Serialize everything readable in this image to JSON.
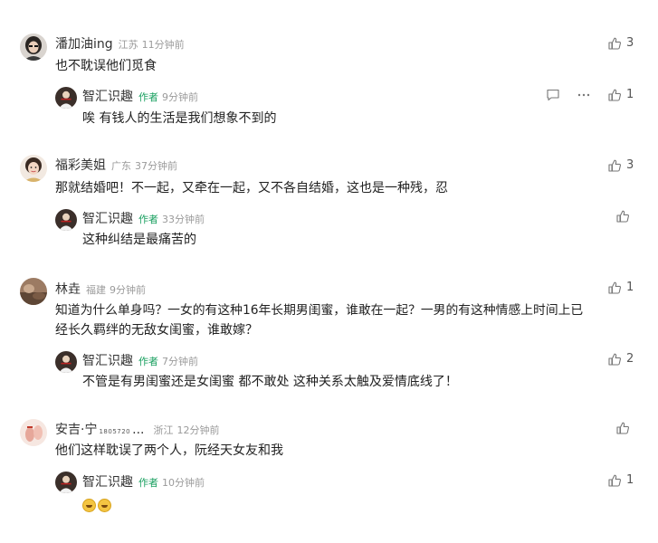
{
  "colors": {
    "author_tag": "#1aa060",
    "meta_text": "#9a9a9a",
    "text": "#222222",
    "icon": "#888888"
  },
  "icons": {
    "like": "thumbs-up-icon",
    "reply": "comment-bubble-icon",
    "more": "more-dots-icon"
  },
  "comments": [
    {
      "user": "潘加油ing",
      "location": "江苏",
      "time": "11分钟前",
      "likes": "3",
      "text": "也不耽误他们觅食",
      "reply": {
        "user": "智汇识趣",
        "author_label": "作者",
        "time": "9分钟前",
        "likes": "1",
        "text": "唉 有钱人的生活是我们想象不到的"
      }
    },
    {
      "user": "福彩美姐",
      "location": "广东",
      "time": "37分钟前",
      "likes": "3",
      "text": "那就结婚吧！不一起，又牵在一起，又不各自结婚，这也是一种残，忍",
      "reply": {
        "user": "智汇识趣",
        "author_label": "作者",
        "time": "33分钟前",
        "likes": "",
        "text": "这种纠结是最痛苦的"
      }
    },
    {
      "user": "林垚",
      "location": "福建",
      "time": "9分钟前",
      "likes": "1",
      "text_line1": "知道为什么单身吗？一女的有这种16年长期男闺蜜，谁敢在一起？一男的有这种情感上时间上已",
      "text_line2": "经长久羁绊的无敌女闺蜜，谁敢嫁？",
      "reply": {
        "user": "智汇识趣",
        "author_label": "作者",
        "time": "7分钟前",
        "likes": "2",
        "text": "不管是有男闺蜜还是女闺蜜 都不敢处 这种关系太触及爱情底线了！"
      }
    },
    {
      "user": "安吉·宁",
      "user_tag": "1805720",
      "user_suffix": "...",
      "location": "浙江",
      "time": "12分钟前",
      "likes": "",
      "text": "他们这样耽误了两个人，阮经天女友和我",
      "reply": {
        "user": "智汇识趣",
        "author_label": "作者",
        "time": "10分钟前",
        "likes": "1",
        "emoji": [
          "laugh-cry-emoji",
          "laugh-cry-emoji"
        ]
      }
    }
  ]
}
